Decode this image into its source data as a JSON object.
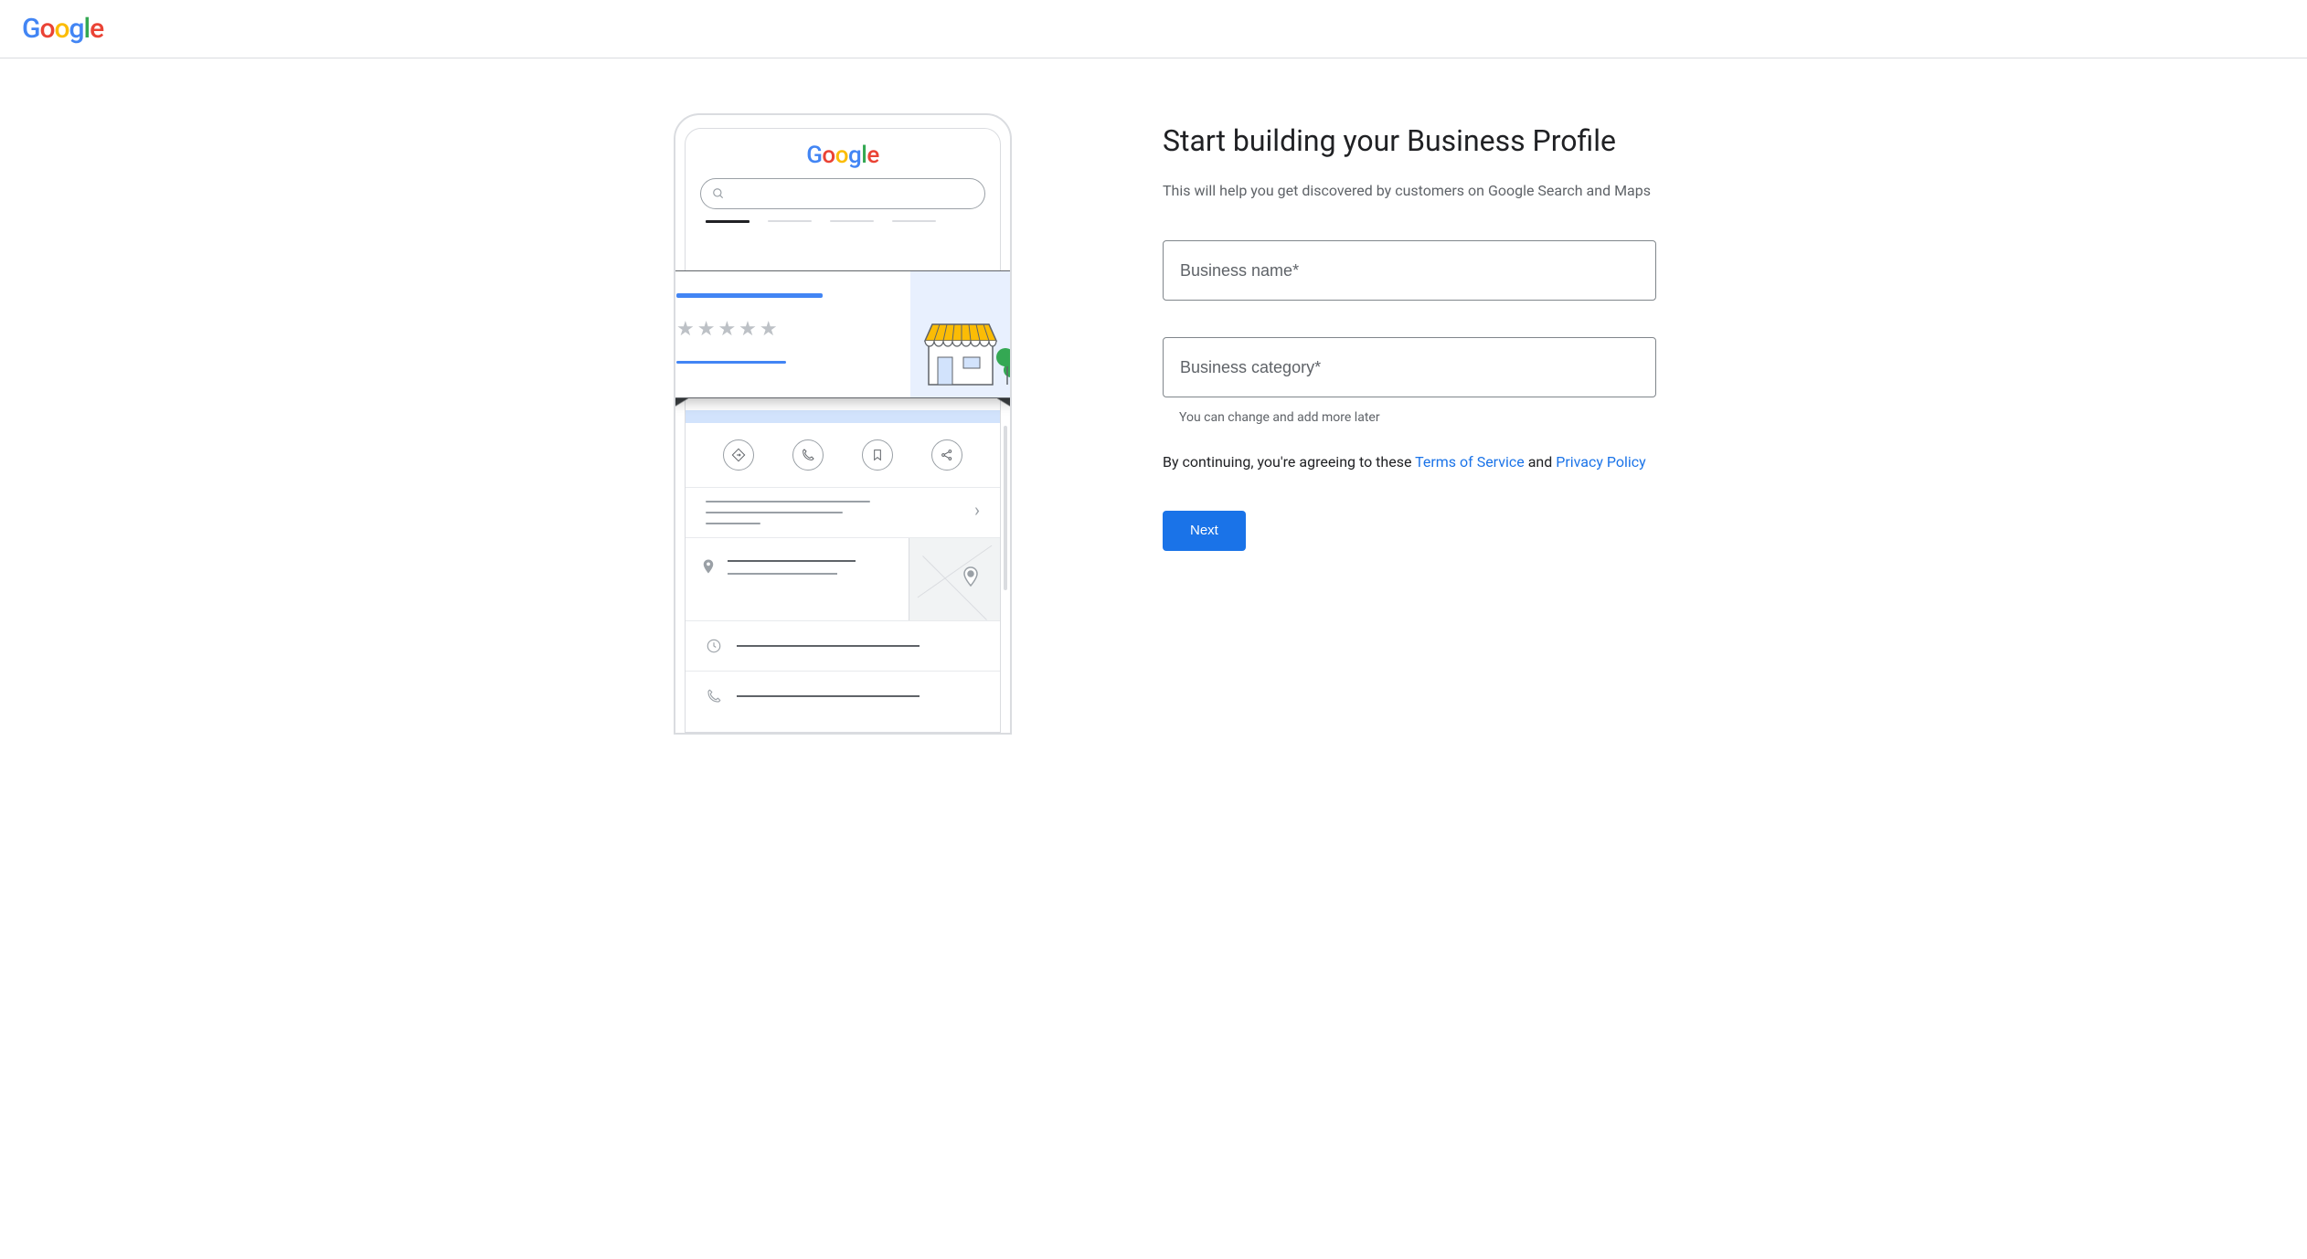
{
  "header": {
    "logo_text": "Google"
  },
  "illustration": {
    "phone_logo": "Google"
  },
  "form": {
    "title": "Start building your Business Profile",
    "subtitle": "This will help you get discovered by customers on Google Search and Maps",
    "business_name": {
      "placeholder": "Business name*",
      "value": ""
    },
    "business_category": {
      "placeholder": "Business category*",
      "value": ""
    },
    "category_helper": "You can change and add more later",
    "legal_prefix": "By continuing, you're agreeing to these ",
    "tos_link": "Terms of Service",
    "legal_and": " and ",
    "privacy_link": "Privacy Policy",
    "next_button": "Next"
  }
}
